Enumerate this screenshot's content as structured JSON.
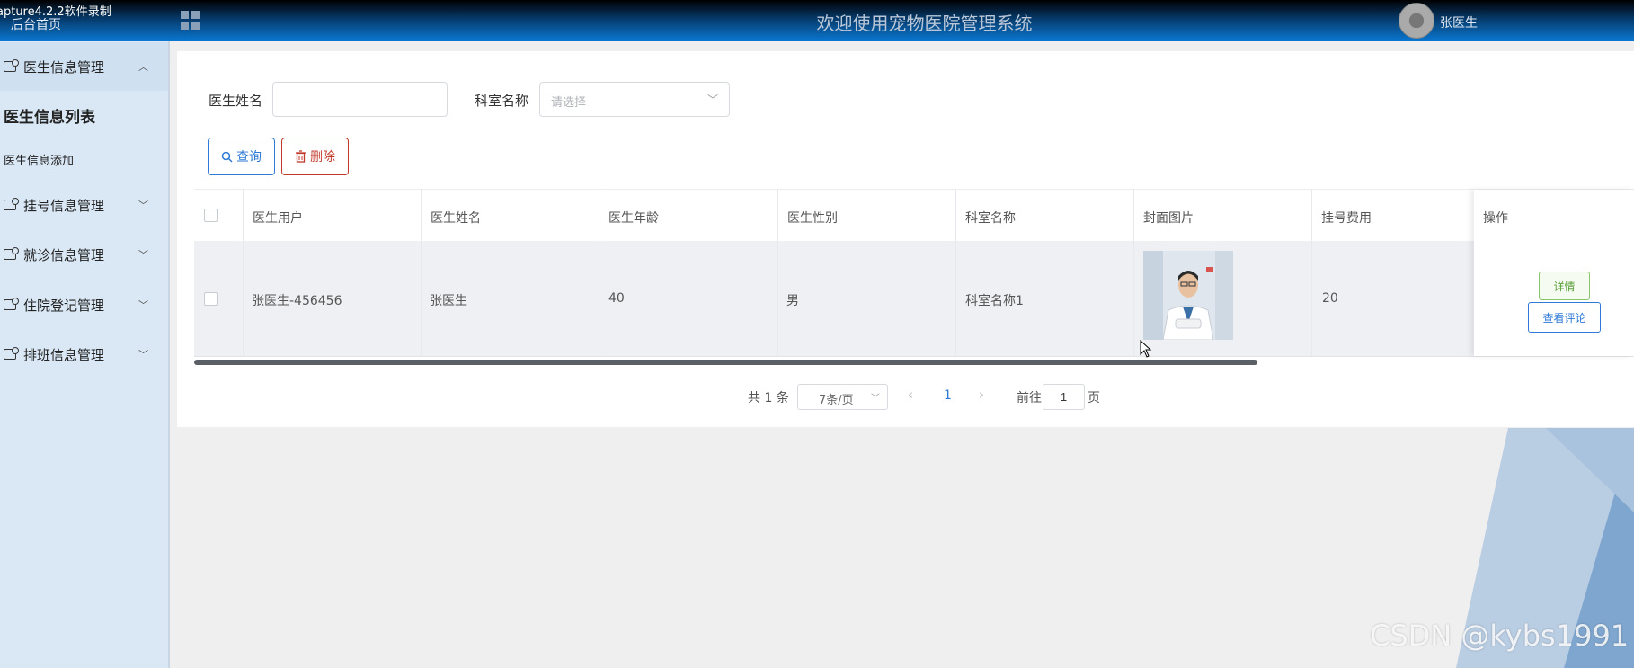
{
  "topbar": {
    "recorder_text": "apture4.2.2软件录制",
    "home_label": "后台首页",
    "system_title": "欢迎使用宠物医院管理系统",
    "user_name": "张医生"
  },
  "sidebar": {
    "groups": [
      {
        "label": "医生信息管理",
        "expanded": true,
        "children": [
          {
            "label": "医生信息列表",
            "active": true
          },
          {
            "label": "医生信息添加",
            "active": false
          }
        ]
      },
      {
        "label": "挂号信息管理",
        "expanded": false
      },
      {
        "label": "就诊信息管理",
        "expanded": false
      },
      {
        "label": "住院登记管理",
        "expanded": false
      },
      {
        "label": "排班信息管理",
        "expanded": false
      }
    ]
  },
  "search": {
    "doctor_name_label": "医生姓名",
    "doctor_name_value": "",
    "department_label": "科室名称",
    "department_placeholder": "请选择"
  },
  "actions": {
    "query_label": "查询",
    "delete_label": "删除"
  },
  "table": {
    "columns": [
      "医生用户",
      "医生姓名",
      "医生年龄",
      "医生性别",
      "科室名称",
      "封面图片",
      "挂号费用",
      "操作"
    ],
    "rows": [
      {
        "doctor_user": "张医生-456456",
        "doctor_name": "张医生",
        "doctor_age": "40",
        "doctor_gender": "男",
        "department": "科室名称1",
        "cover_image": "doctor-photo",
        "fee": "20",
        "actions": {
          "detail_label": "详情",
          "comments_label": "查看评论"
        }
      }
    ]
  },
  "pagination": {
    "total_text": "共 1 条",
    "page_size": "7条/页",
    "current_page": "1",
    "goto_label": "前往",
    "goto_value": "1",
    "page_suffix": "页"
  },
  "watermark": "CSDN @kybs1991",
  "colors": {
    "primary": "#2f7ad6",
    "danger": "#c0392b",
    "success": "#5aa03a",
    "sidebar_bg": "#dae8f5"
  }
}
